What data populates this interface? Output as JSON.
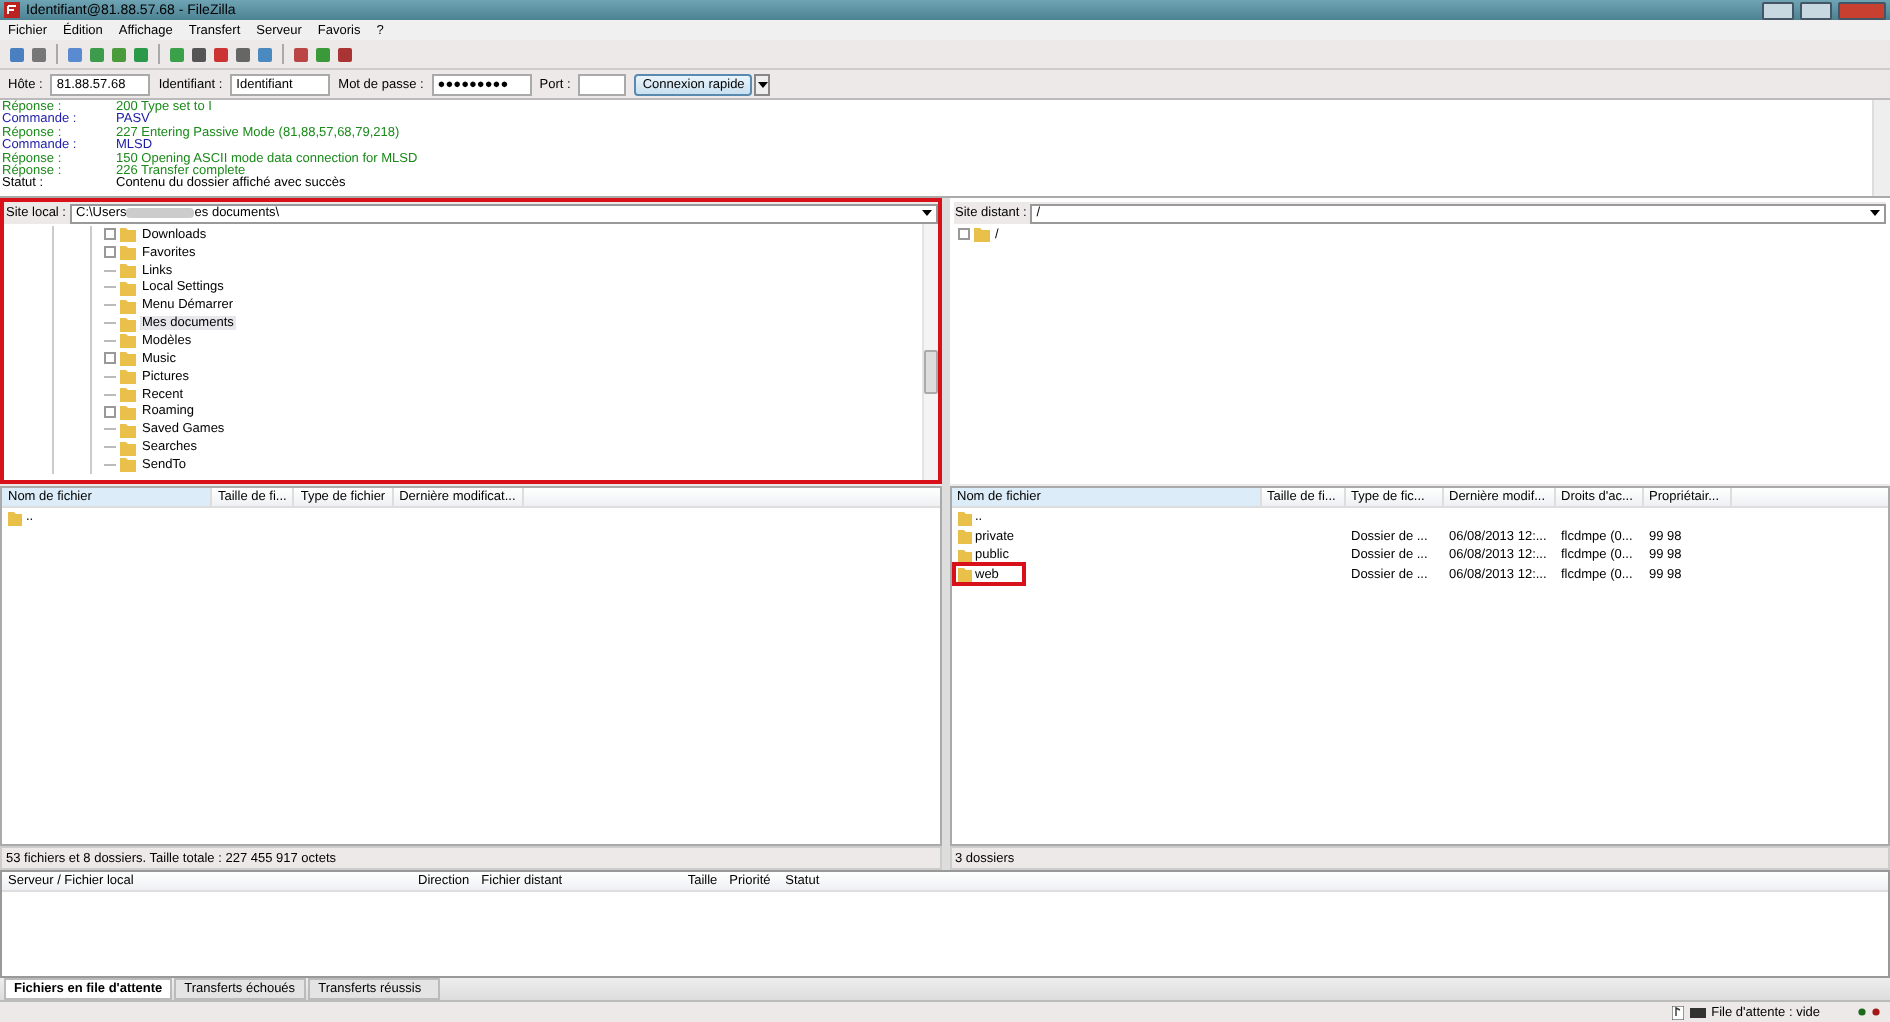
{
  "window": {
    "title": "Identifiant@81.88.57.68 - FileZilla"
  },
  "menu": [
    "Fichier",
    "Édition",
    "Affichage",
    "Transfert",
    "Serveur",
    "Favoris",
    "?"
  ],
  "quickconnect": {
    "host_label": "Hôte :",
    "host": "81.88.57.68",
    "user_label": "Identifiant :",
    "user": "Identifiant",
    "pass_label": "Mot de passe :",
    "pass": "●●●●●●●●●",
    "port_label": "Port :",
    "button": "Connexion rapide"
  },
  "log": [
    {
      "kind": "reponse",
      "label": "Réponse :",
      "text": "200 Type set to I"
    },
    {
      "kind": "commande",
      "label": "Commande :",
      "text": "PASV"
    },
    {
      "kind": "reponse",
      "label": "Réponse :",
      "text": "227 Entering Passive Mode (81,88,57,68,79,218)"
    },
    {
      "kind": "commande",
      "label": "Commande :",
      "text": "MLSD"
    },
    {
      "kind": "reponse",
      "label": "Réponse :",
      "text": "150 Opening ASCII mode data connection for MLSD"
    },
    {
      "kind": "reponse",
      "label": "Réponse :",
      "text": "226 Transfer complete"
    },
    {
      "kind": "statut",
      "label": "Statut :",
      "text": "Contenu du dossier affiché avec succès"
    }
  ],
  "local": {
    "label": "Site local :",
    "path_start": "C:\\Users",
    "path_end": "es documents\\",
    "highlight": true,
    "tree": [
      {
        "name": "Downloads",
        "expandable": true,
        "selected": false
      },
      {
        "name": "Favorites",
        "expandable": true,
        "selected": false
      },
      {
        "name": "Links",
        "expandable": false,
        "selected": false
      },
      {
        "name": "Local Settings",
        "expandable": false,
        "selected": false
      },
      {
        "name": "Menu Démarrer",
        "expandable": false,
        "selected": false
      },
      {
        "name": "Mes documents",
        "expandable": false,
        "selected": true
      },
      {
        "name": "Modèles",
        "expandable": false,
        "selected": false
      },
      {
        "name": "Music",
        "expandable": true,
        "selected": false
      },
      {
        "name": "Pictures",
        "expandable": false,
        "selected": false
      },
      {
        "name": "Recent",
        "expandable": false,
        "selected": false
      },
      {
        "name": "Roaming",
        "expandable": true,
        "selected": false
      },
      {
        "name": "Saved Games",
        "expandable": false,
        "selected": false
      },
      {
        "name": "Searches",
        "expandable": false,
        "selected": false
      },
      {
        "name": "SendTo",
        "expandable": false,
        "selected": false
      }
    ],
    "columns": [
      "Nom de fichier",
      "Taille de fi...",
      "Type de fichier",
      "Dernière modificat..."
    ],
    "rows": [
      {
        "name": "..",
        "highlight": false
      }
    ],
    "status": "53 fichiers et 8 dossiers. Taille totale : 227 455 917 octets"
  },
  "remote": {
    "label": "Site distant :",
    "path": "/",
    "highlight": false,
    "tree": [
      {
        "name": "/",
        "expandable": true,
        "selected": false
      }
    ],
    "columns": [
      "Nom de fichier",
      "Taille de fi...",
      "Type de fic...",
      "Dernière modif...",
      "Droits d'ac...",
      "Propriétair..."
    ],
    "rows": [
      {
        "name": "..",
        "highlight": false
      },
      {
        "name": "private",
        "type": "Dossier de ...",
        "modified": "06/08/2013 12:...",
        "rights": "flcdmpe (0...",
        "owner": "99 98",
        "highlight": false
      },
      {
        "name": "public",
        "type": "Dossier de ...",
        "modified": "06/08/2013 12:...",
        "rights": "flcdmpe (0...",
        "owner": "99 98",
        "highlight": false
      },
      {
        "name": "web",
        "type": "Dossier de ...",
        "modified": "06/08/2013 12:...",
        "rights": "flcdmpe (0...",
        "owner": "99 98",
        "highlight": true
      }
    ],
    "status": "3 dossiers"
  },
  "queue": {
    "columns": [
      "Serveur / Fichier local",
      "Direction",
      "Fichier distant",
      "Taille",
      "Priorité",
      "Statut"
    ]
  },
  "tabs": [
    {
      "label": "Fichiers en file d'attente",
      "selected": true
    },
    {
      "label": "Transferts échoués",
      "selected": false
    },
    {
      "label": "Transferts réussis",
      "selected": false
    }
  ],
  "status_bar": {
    "queue": "File d'attente : vide"
  }
}
